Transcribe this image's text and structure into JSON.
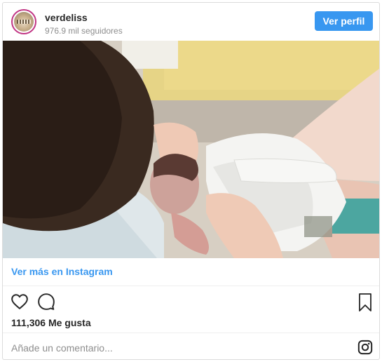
{
  "post": {
    "username": "verdeliss",
    "followers": "976.9 mil seguidores",
    "profile_button": "Ver perfil",
    "view_more_link": "Ver más en Instagram",
    "likes": "111,306 Me gusta",
    "comment_placeholder": "Añade un comentario..."
  },
  "icons": {
    "like": "heart-icon",
    "comment": "comment-bubble-icon",
    "save": "bookmark-icon",
    "instagram": "instagram-logo-icon"
  },
  "colors": {
    "accent": "#3897f0",
    "text": "#262626",
    "muted": "#8e8e8e",
    "border": "#dbdbdb"
  }
}
